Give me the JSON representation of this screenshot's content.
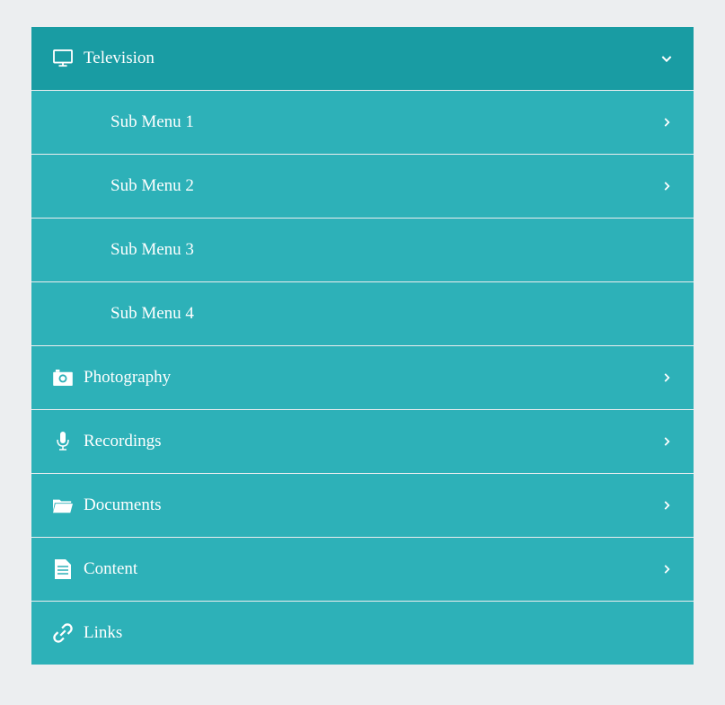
{
  "menu": {
    "items": [
      {
        "label": "Television",
        "icon": "tv-icon",
        "expanded": true,
        "hasChevron": true,
        "children": [
          {
            "label": "Sub Menu 1",
            "hasChevron": true
          },
          {
            "label": "Sub Menu 2",
            "hasChevron": true
          },
          {
            "label": "Sub Menu 3",
            "hasChevron": false
          },
          {
            "label": "Sub Menu 4",
            "hasChevron": false
          }
        ]
      },
      {
        "label": "Photography",
        "icon": "camera-icon",
        "hasChevron": true
      },
      {
        "label": "Recordings",
        "icon": "microphone-icon",
        "hasChevron": true
      },
      {
        "label": "Documents",
        "icon": "folder-open-icon",
        "hasChevron": true
      },
      {
        "label": "Content",
        "icon": "file-text-icon",
        "hasChevron": true
      },
      {
        "label": "Links",
        "icon": "link-icon",
        "hasChevron": false
      }
    ]
  }
}
